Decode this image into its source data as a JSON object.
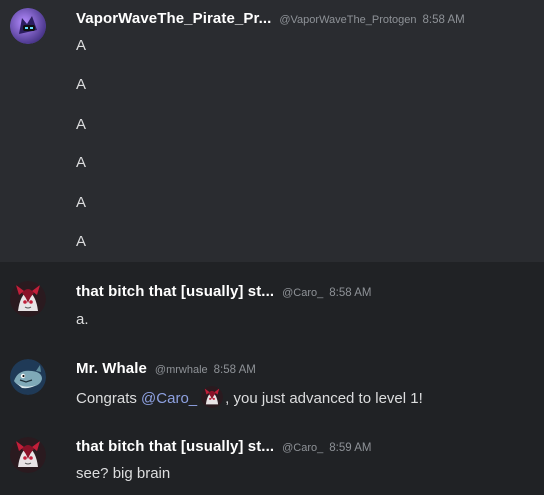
{
  "messages": [
    {
      "author": "VaporWaveThe_Pirate_Pr...",
      "handle": "@VaporWaveThe_Protogen",
      "time": "8:58 AM",
      "avatar_icon": "protogen-avatar",
      "lines": [
        "A",
        "A",
        "A",
        "A",
        "A",
        "A"
      ]
    },
    {
      "author": "that bitch that [usually] st...",
      "handle": "@Caro_",
      "time": "8:58 AM",
      "avatar_icon": "caro-avatar",
      "lines": [
        "a."
      ]
    },
    {
      "author": "Mr. Whale",
      "handle": "@mrwhale",
      "time": "8:58 AM",
      "avatar_icon": "whale-avatar",
      "text_before": "Congrats ",
      "mention": "@Caro_",
      "text_after": ", you just advanced to level 1!"
    },
    {
      "author": "that bitch that [usually] st...",
      "handle": "@Caro_",
      "time": "8:59 AM",
      "avatar_icon": "caro-avatar",
      "lines": [
        "see? big brain"
      ]
    }
  ],
  "colors": {
    "background": "#202225",
    "hover_background": "#2a2c30",
    "author": "#ffffff",
    "meta": "#8e9297",
    "text": "#dcddde",
    "mention": "#8ea1e1"
  }
}
